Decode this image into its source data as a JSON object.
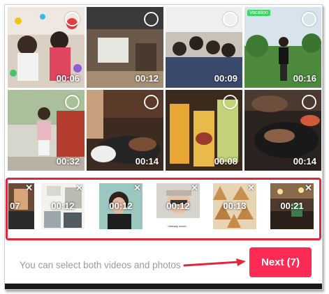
{
  "grid": {
    "tiles": [
      {
        "duration": "00:06"
      },
      {
        "duration": "00:12"
      },
      {
        "duration": "00:09"
      },
      {
        "duration": "00:16"
      },
      {
        "duration": "00:32"
      },
      {
        "duration": "00:14"
      },
      {
        "duration": "00:08"
      },
      {
        "duration": "00:14"
      }
    ],
    "sticker_text": "Vacation"
  },
  "selected": {
    "items": [
      {
        "duration": "07"
      },
      {
        "duration": "00:12"
      },
      {
        "duration": "00:12"
      },
      {
        "duration": "00:12"
      },
      {
        "duration": "00:13"
      },
      {
        "duration": "00:21"
      }
    ],
    "remove_glyph": "✕",
    "caption_text": "i already would…"
  },
  "footer": {
    "hint": "You can select both videos and photos",
    "next_label": "Next (7)"
  },
  "colors": {
    "accent": "#fe2c55",
    "annotation": "#e3263b"
  }
}
